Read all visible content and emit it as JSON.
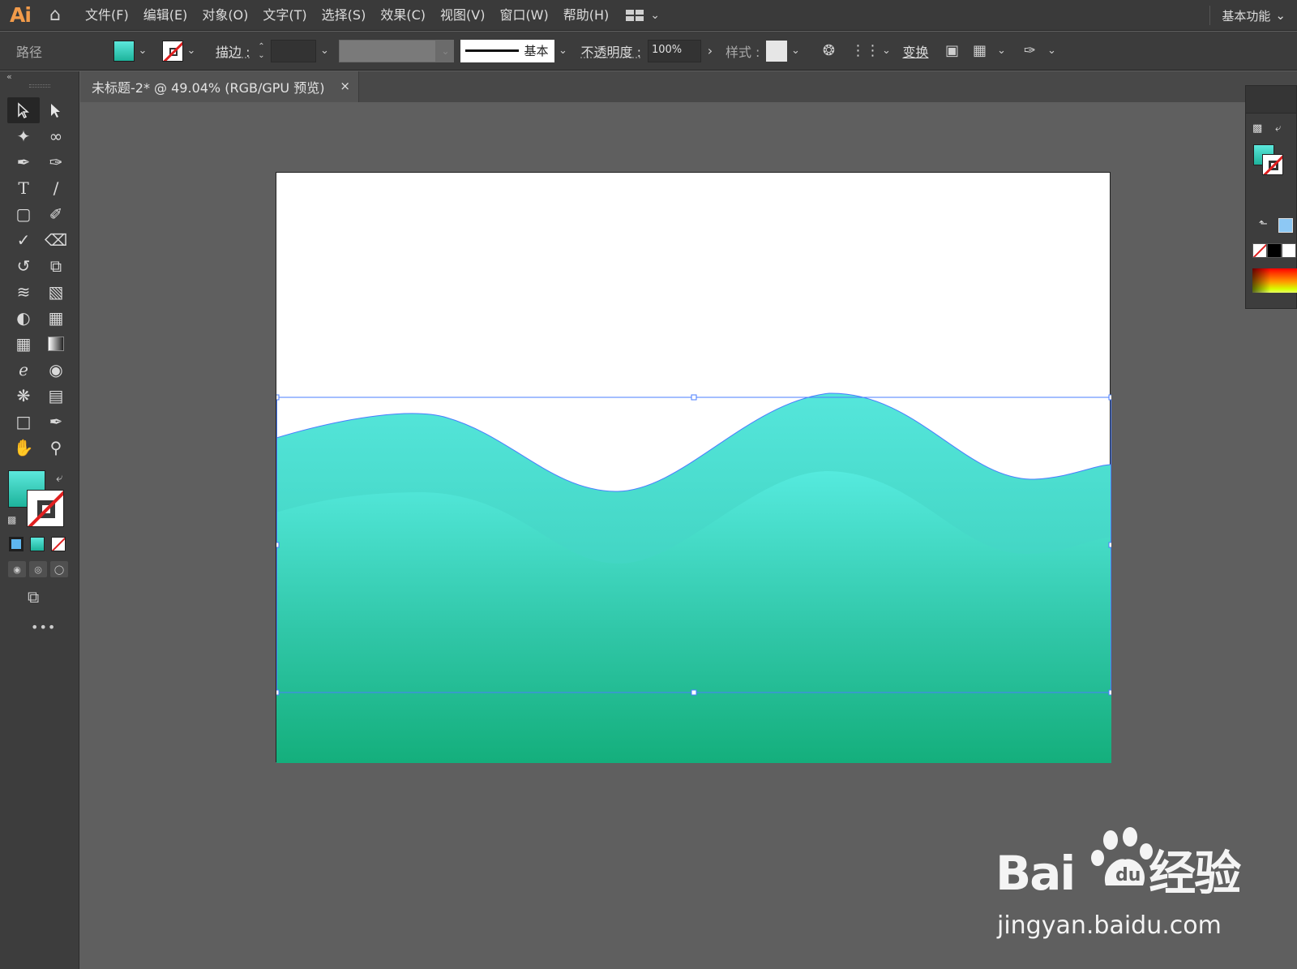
{
  "app": {
    "logo": "Ai",
    "menus": [
      "文件(F)",
      "编辑(E)",
      "对象(O)",
      "文字(T)",
      "选择(S)",
      "效果(C)",
      "视图(V)",
      "窗口(W)",
      "帮助(H)"
    ],
    "workspace": "基本功能"
  },
  "control_bar": {
    "object_label": "路径",
    "stroke_label": "描边 :",
    "brush_label": "基本",
    "opacity_label": "不透明度 :",
    "opacity_value": "100%",
    "style_label": "样式 :",
    "transform_label": "变换"
  },
  "document": {
    "tab_title": "未标题-2* @ 49.04% (RGB/GPU 预览)",
    "close_glyph": "×"
  },
  "colors": {
    "accent_fill_top": "#5ce8dc",
    "accent_fill_bottom": "#13b07d",
    "selection": "#4a7cff",
    "stroke_none": "#e02020"
  },
  "watermark": {
    "brand": "Bai",
    "brand_suffix": "经验",
    "url": "jingyan.baidu.com"
  }
}
